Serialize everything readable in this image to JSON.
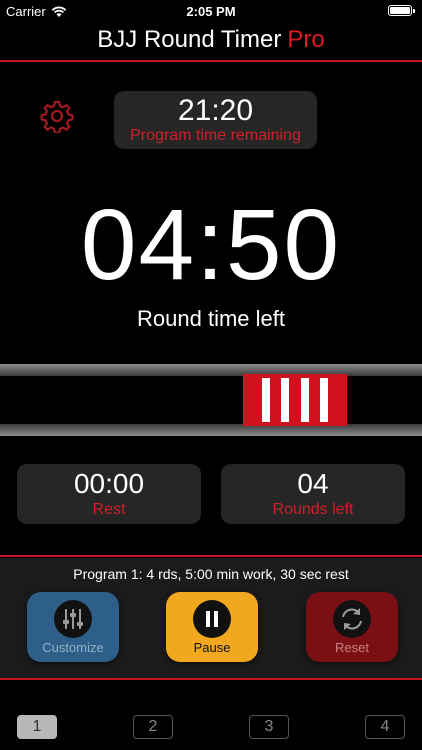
{
  "status_bar": {
    "carrier": "Carrier",
    "time": "2:05 PM"
  },
  "app": {
    "title": "BJJ Round Timer",
    "title_suffix": "Pro",
    "accent": "#e11a22"
  },
  "program_remaining": {
    "value": "21:20",
    "label": "Program time remaining"
  },
  "round": {
    "value": "04:50",
    "label": "Round time left"
  },
  "rest": {
    "value": "00:00",
    "label": "Rest"
  },
  "rounds_left": {
    "value": "04",
    "label": "Rounds left"
  },
  "program_summary": "Program 1: 4 rds, 5:00 min work, 30 sec rest",
  "controls": {
    "customize": "Customize",
    "pause": "Pause",
    "reset": "Reset"
  },
  "tabs": [
    {
      "label": "1",
      "active": true
    },
    {
      "label": "2",
      "active": false
    },
    {
      "label": "3",
      "active": false
    },
    {
      "label": "4",
      "active": false
    }
  ],
  "icons": [
    "wifi-icon",
    "battery-icon",
    "gear-icon",
    "sliders-icon",
    "pause-icon",
    "reset-icon"
  ]
}
